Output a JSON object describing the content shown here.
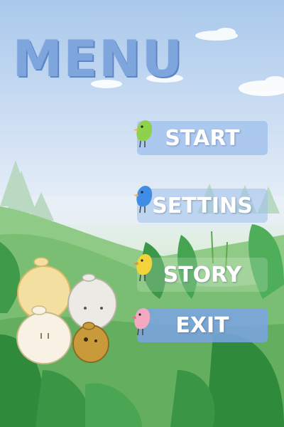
{
  "menu": {
    "title": "MENU",
    "buttons": [
      {
        "label": "START"
      },
      {
        "label": "SETTINS"
      },
      {
        "label": "STORY"
      },
      {
        "label": "EXIT"
      }
    ]
  },
  "colors": {
    "title": "#7fa6dc",
    "button": "#a4c3ec",
    "button_exit": "#7aa4e0",
    "bird_green": "#8ed14a",
    "bird_blue": "#3f8ee6",
    "bird_yellow": "#f2d43a",
    "bird_pink": "#f4a9c0"
  },
  "icons": [
    "green-bird-icon",
    "blue-bird-icon",
    "yellow-bird-icon",
    "pink-bird-icon"
  ]
}
